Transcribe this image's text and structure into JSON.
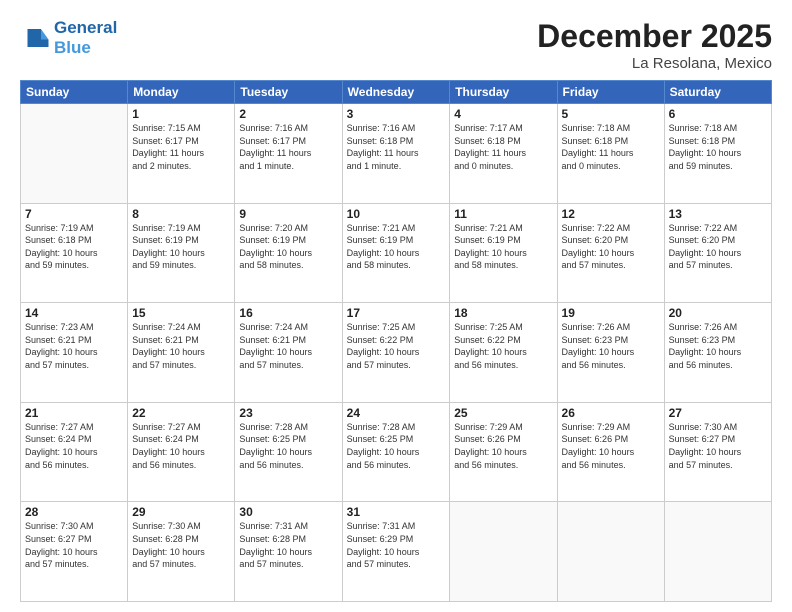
{
  "header": {
    "logo_line1": "General",
    "logo_line2": "Blue",
    "month": "December 2025",
    "location": "La Resolana, Mexico"
  },
  "weekdays": [
    "Sunday",
    "Monday",
    "Tuesday",
    "Wednesday",
    "Thursday",
    "Friday",
    "Saturday"
  ],
  "weeks": [
    [
      {
        "day": "",
        "info": ""
      },
      {
        "day": "1",
        "info": "Sunrise: 7:15 AM\nSunset: 6:17 PM\nDaylight: 11 hours\nand 2 minutes."
      },
      {
        "day": "2",
        "info": "Sunrise: 7:16 AM\nSunset: 6:17 PM\nDaylight: 11 hours\nand 1 minute."
      },
      {
        "day": "3",
        "info": "Sunrise: 7:16 AM\nSunset: 6:18 PM\nDaylight: 11 hours\nand 1 minute."
      },
      {
        "day": "4",
        "info": "Sunrise: 7:17 AM\nSunset: 6:18 PM\nDaylight: 11 hours\nand 0 minutes."
      },
      {
        "day": "5",
        "info": "Sunrise: 7:18 AM\nSunset: 6:18 PM\nDaylight: 11 hours\nand 0 minutes."
      },
      {
        "day": "6",
        "info": "Sunrise: 7:18 AM\nSunset: 6:18 PM\nDaylight: 10 hours\nand 59 minutes."
      }
    ],
    [
      {
        "day": "7",
        "info": "Sunrise: 7:19 AM\nSunset: 6:18 PM\nDaylight: 10 hours\nand 59 minutes."
      },
      {
        "day": "8",
        "info": "Sunrise: 7:19 AM\nSunset: 6:19 PM\nDaylight: 10 hours\nand 59 minutes."
      },
      {
        "day": "9",
        "info": "Sunrise: 7:20 AM\nSunset: 6:19 PM\nDaylight: 10 hours\nand 58 minutes."
      },
      {
        "day": "10",
        "info": "Sunrise: 7:21 AM\nSunset: 6:19 PM\nDaylight: 10 hours\nand 58 minutes."
      },
      {
        "day": "11",
        "info": "Sunrise: 7:21 AM\nSunset: 6:19 PM\nDaylight: 10 hours\nand 58 minutes."
      },
      {
        "day": "12",
        "info": "Sunrise: 7:22 AM\nSunset: 6:20 PM\nDaylight: 10 hours\nand 57 minutes."
      },
      {
        "day": "13",
        "info": "Sunrise: 7:22 AM\nSunset: 6:20 PM\nDaylight: 10 hours\nand 57 minutes."
      }
    ],
    [
      {
        "day": "14",
        "info": "Sunrise: 7:23 AM\nSunset: 6:21 PM\nDaylight: 10 hours\nand 57 minutes."
      },
      {
        "day": "15",
        "info": "Sunrise: 7:24 AM\nSunset: 6:21 PM\nDaylight: 10 hours\nand 57 minutes."
      },
      {
        "day": "16",
        "info": "Sunrise: 7:24 AM\nSunset: 6:21 PM\nDaylight: 10 hours\nand 57 minutes."
      },
      {
        "day": "17",
        "info": "Sunrise: 7:25 AM\nSunset: 6:22 PM\nDaylight: 10 hours\nand 57 minutes."
      },
      {
        "day": "18",
        "info": "Sunrise: 7:25 AM\nSunset: 6:22 PM\nDaylight: 10 hours\nand 56 minutes."
      },
      {
        "day": "19",
        "info": "Sunrise: 7:26 AM\nSunset: 6:23 PM\nDaylight: 10 hours\nand 56 minutes."
      },
      {
        "day": "20",
        "info": "Sunrise: 7:26 AM\nSunset: 6:23 PM\nDaylight: 10 hours\nand 56 minutes."
      }
    ],
    [
      {
        "day": "21",
        "info": "Sunrise: 7:27 AM\nSunset: 6:24 PM\nDaylight: 10 hours\nand 56 minutes."
      },
      {
        "day": "22",
        "info": "Sunrise: 7:27 AM\nSunset: 6:24 PM\nDaylight: 10 hours\nand 56 minutes."
      },
      {
        "day": "23",
        "info": "Sunrise: 7:28 AM\nSunset: 6:25 PM\nDaylight: 10 hours\nand 56 minutes."
      },
      {
        "day": "24",
        "info": "Sunrise: 7:28 AM\nSunset: 6:25 PM\nDaylight: 10 hours\nand 56 minutes."
      },
      {
        "day": "25",
        "info": "Sunrise: 7:29 AM\nSunset: 6:26 PM\nDaylight: 10 hours\nand 56 minutes."
      },
      {
        "day": "26",
        "info": "Sunrise: 7:29 AM\nSunset: 6:26 PM\nDaylight: 10 hours\nand 56 minutes."
      },
      {
        "day": "27",
        "info": "Sunrise: 7:30 AM\nSunset: 6:27 PM\nDaylight: 10 hours\nand 57 minutes."
      }
    ],
    [
      {
        "day": "28",
        "info": "Sunrise: 7:30 AM\nSunset: 6:27 PM\nDaylight: 10 hours\nand 57 minutes."
      },
      {
        "day": "29",
        "info": "Sunrise: 7:30 AM\nSunset: 6:28 PM\nDaylight: 10 hours\nand 57 minutes."
      },
      {
        "day": "30",
        "info": "Sunrise: 7:31 AM\nSunset: 6:28 PM\nDaylight: 10 hours\nand 57 minutes."
      },
      {
        "day": "31",
        "info": "Sunrise: 7:31 AM\nSunset: 6:29 PM\nDaylight: 10 hours\nand 57 minutes."
      },
      {
        "day": "",
        "info": ""
      },
      {
        "day": "",
        "info": ""
      },
      {
        "day": "",
        "info": ""
      }
    ]
  ]
}
